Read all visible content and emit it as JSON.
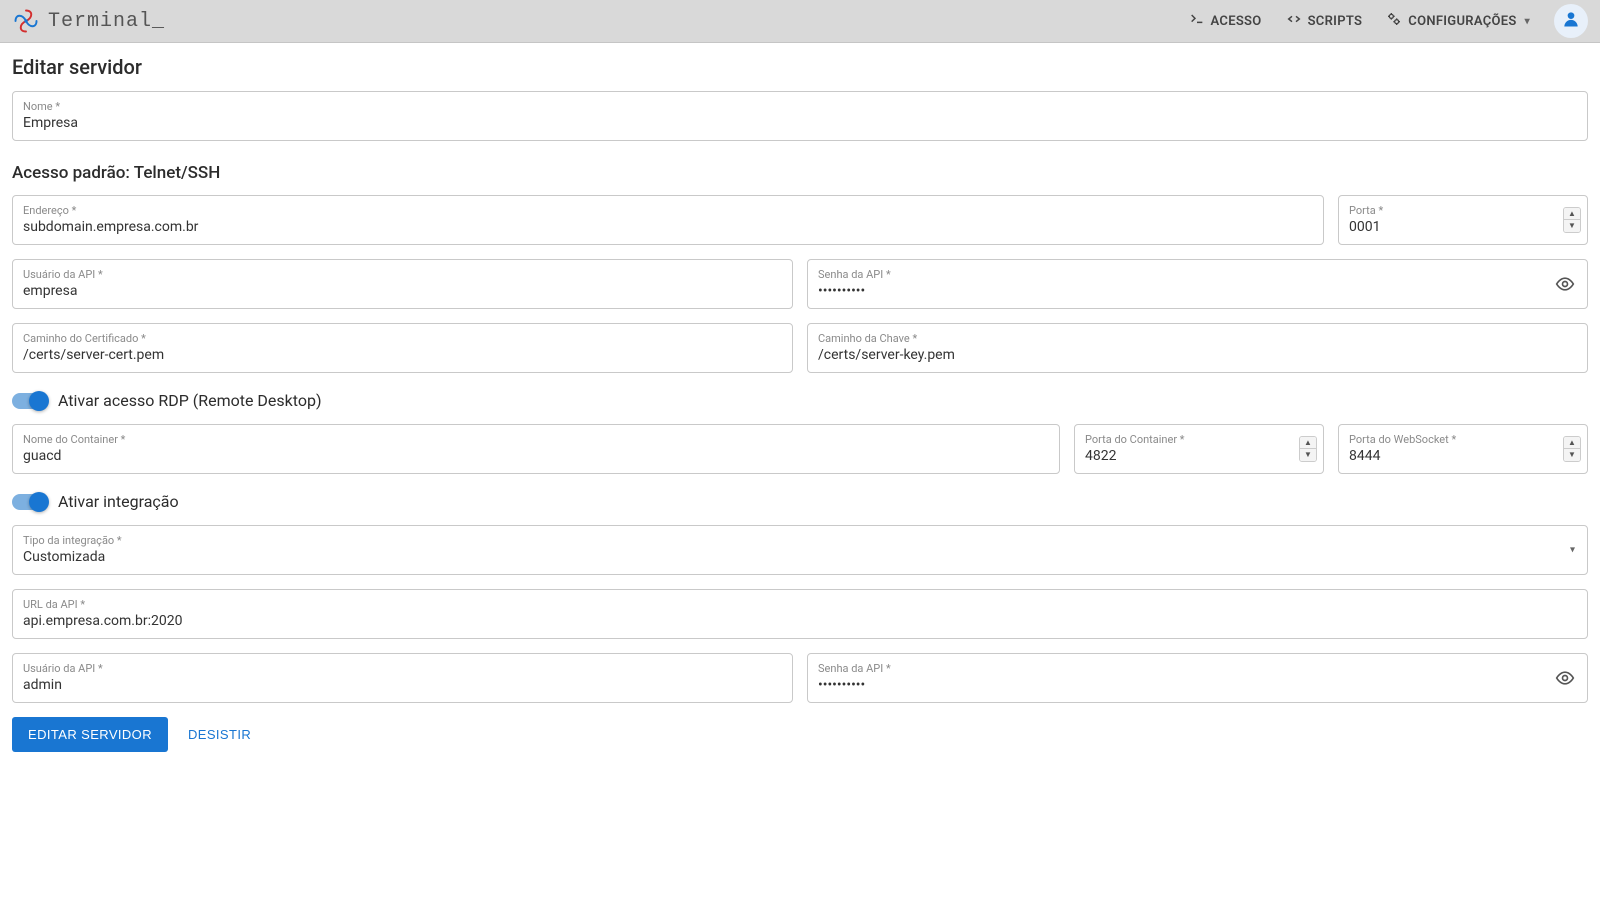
{
  "header": {
    "app_title": "Terminal_",
    "nav": {
      "acesso": "ACESSO",
      "scripts": "SCRIPTS",
      "config": "CONFIGURAÇÕES"
    }
  },
  "page": {
    "title": "Editar servidor",
    "section_default_access": "Acesso padrão: Telnet/SSH"
  },
  "fields": {
    "nome": {
      "label": "Nome *",
      "value": "Empresa"
    },
    "endereco": {
      "label": "Endereço *",
      "value": "subdomain.empresa.com.br"
    },
    "porta": {
      "label": "Porta *",
      "value": "0001"
    },
    "api_user": {
      "label": "Usuário da API *",
      "value": "empresa"
    },
    "api_pass": {
      "label": "Senha da API *",
      "value": "••••••••••"
    },
    "cert_path": {
      "label": "Caminho do Certificado *",
      "value": "/certs/server-cert.pem"
    },
    "key_path": {
      "label": "Caminho da Chave *",
      "value": "/certs/server-key.pem"
    }
  },
  "rdp": {
    "toggle_label": "Ativar acesso RDP (Remote Desktop)",
    "container_name": {
      "label": "Nome do Container *",
      "value": "guacd"
    },
    "container_port": {
      "label": "Porta do Container *",
      "value": "4822"
    },
    "ws_port": {
      "label": "Porta do WebSocket *",
      "value": "8444"
    }
  },
  "integration": {
    "toggle_label": "Ativar integração",
    "type": {
      "label": "Tipo da integração *",
      "value": "Customizada"
    },
    "api_url": {
      "label": "URL da API *",
      "value": "api.empresa.com.br:2020"
    },
    "api_user": {
      "label": "Usuário da API *",
      "value": "admin"
    },
    "api_pass": {
      "label": "Senha da API *",
      "value": "••••••••••"
    }
  },
  "actions": {
    "submit": "EDITAR SERVIDOR",
    "cancel": "DESISTIR"
  }
}
